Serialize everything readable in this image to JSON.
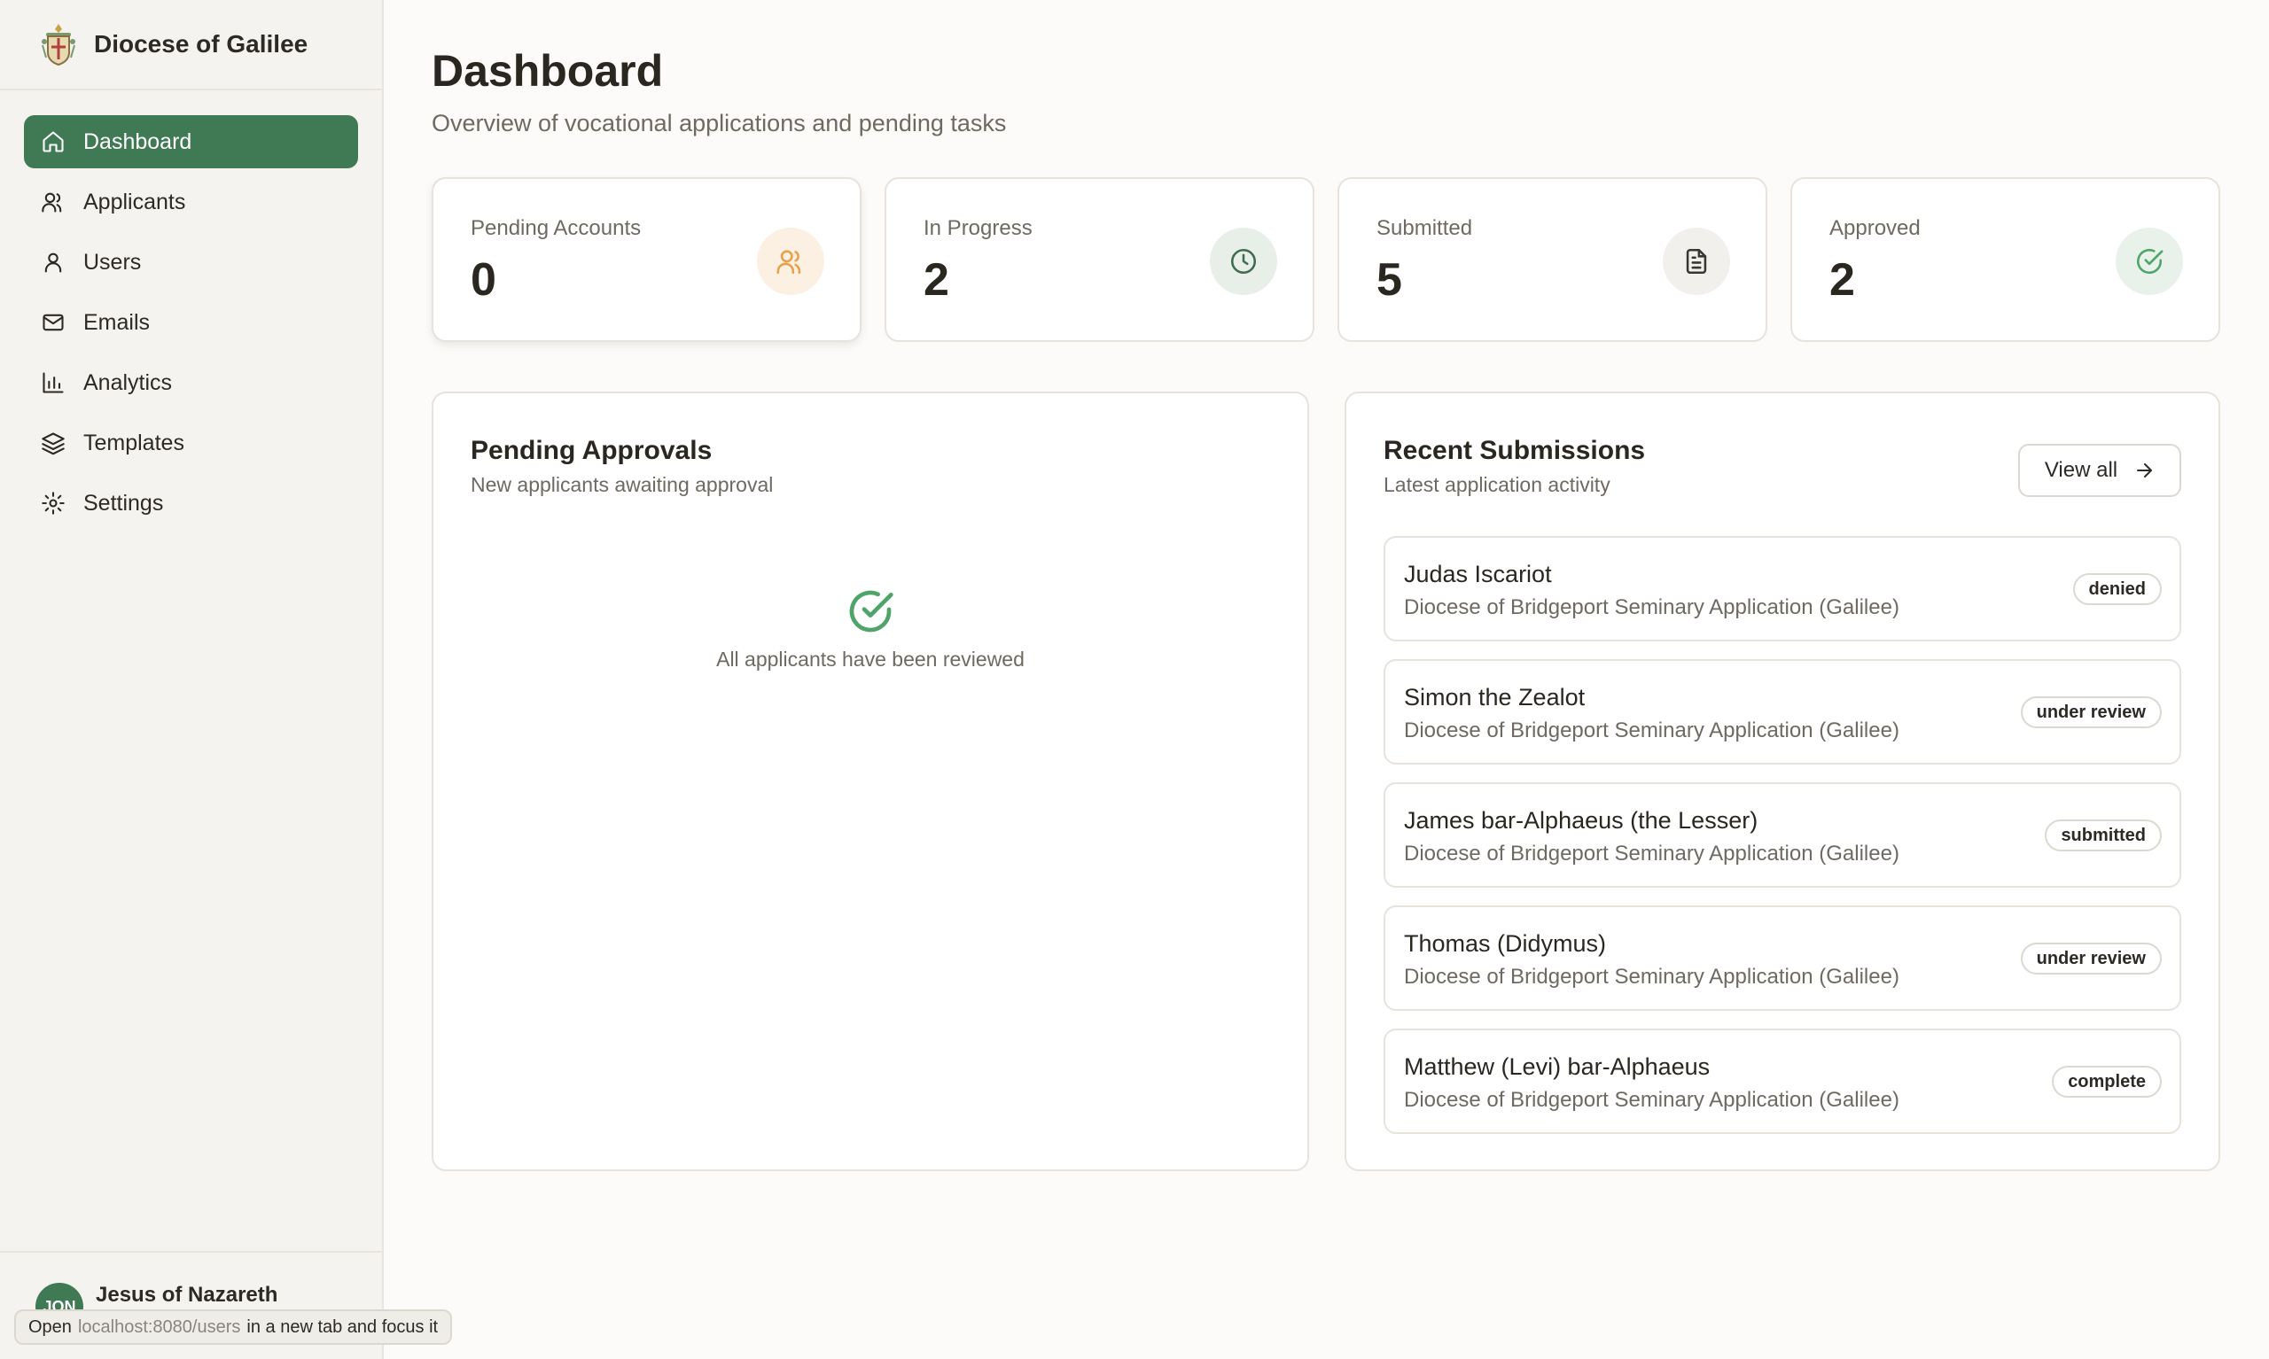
{
  "sidebar": {
    "brand": "Diocese of Galilee",
    "items": [
      {
        "label": "Dashboard",
        "icon": "home-icon",
        "active": true
      },
      {
        "label": "Applicants",
        "icon": "users-icon"
      },
      {
        "label": "Users",
        "icon": "user-icon"
      },
      {
        "label": "Emails",
        "icon": "mail-icon"
      },
      {
        "label": "Analytics",
        "icon": "bar-chart-icon"
      },
      {
        "label": "Templates",
        "icon": "layers-icon"
      },
      {
        "label": "Settings",
        "icon": "gear-icon"
      }
    ],
    "user": {
      "initials": "JON",
      "name": "Jesus of Nazareth"
    }
  },
  "tooltip": {
    "prefix": "Open",
    "url": "localhost:8080/users",
    "suffix": "in a new tab and focus it"
  },
  "header": {
    "title": "Dashboard",
    "subtitle": "Overview of vocational applications and pending tasks"
  },
  "stats": [
    {
      "label": "Pending Accounts",
      "value": "0",
      "icon": "users-icon",
      "icon_color": "#e8a04a",
      "icon_bg": "#fbf0e2"
    },
    {
      "label": "In Progress",
      "value": "2",
      "icon": "clock-icon",
      "icon_color": "#3f6b51",
      "icon_bg": "#e8efe9"
    },
    {
      "label": "Submitted",
      "value": "5",
      "icon": "document-icon",
      "icon_color": "#3a3731",
      "icon_bg": "#f2f0ec"
    },
    {
      "label": "Approved",
      "value": "2",
      "icon": "check-circle-icon",
      "icon_color": "#4fa46a",
      "icon_bg": "#e8f2eb"
    }
  ],
  "pending": {
    "title": "Pending Approvals",
    "subtitle": "New applicants awaiting approval",
    "empty_text": "All applicants have been reviewed"
  },
  "recent": {
    "title": "Recent Submissions",
    "subtitle": "Latest application activity",
    "view_all": "View all",
    "items": [
      {
        "name": "Judas Iscariot",
        "desc": "Diocese of Bridgeport Seminary Application (Galilee)",
        "status": "denied"
      },
      {
        "name": "Simon the Zealot",
        "desc": "Diocese of Bridgeport Seminary Application (Galilee)",
        "status": "under review"
      },
      {
        "name": "James bar-Alphaeus (the Lesser)",
        "desc": "Diocese of Bridgeport Seminary Application (Galilee)",
        "status": "submitted"
      },
      {
        "name": "Thomas (Didymus)",
        "desc": "Diocese of Bridgeport Seminary Application (Galilee)",
        "status": "under review"
      },
      {
        "name": "Matthew (Levi) bar-Alphaeus",
        "desc": "Diocese of Bridgeport Seminary Application (Galilee)",
        "status": "complete"
      }
    ]
  },
  "colors": {
    "accent": "#3f7a55",
    "background": "#fcfbf9",
    "sidebar": "#f5f3ef"
  }
}
